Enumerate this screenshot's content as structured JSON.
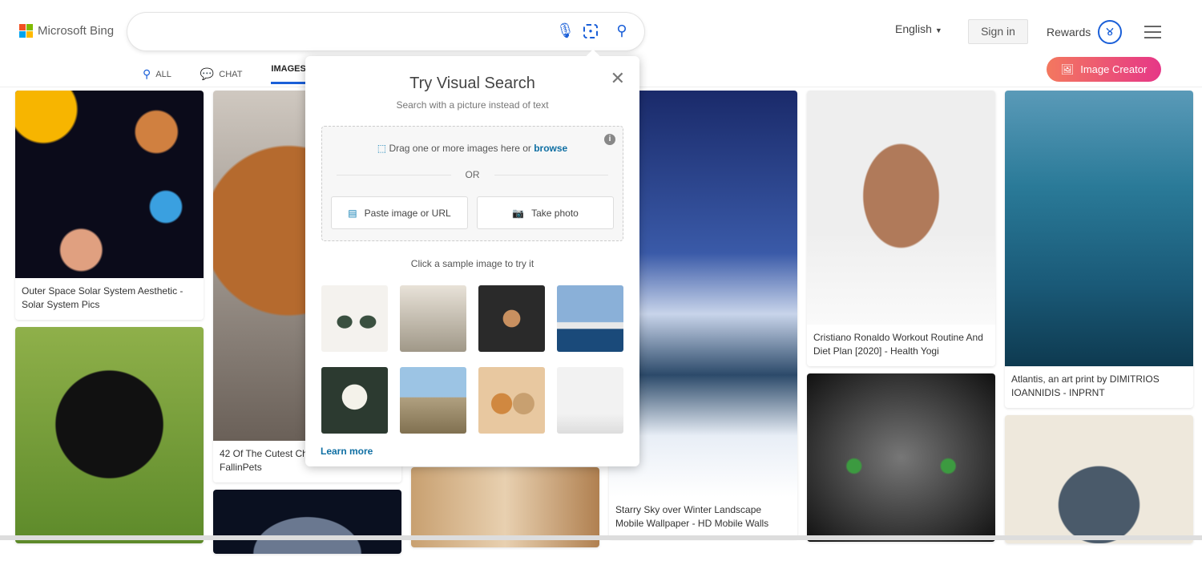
{
  "header": {
    "brand": "Microsoft Bing",
    "search_value": "",
    "language": "English",
    "sign_in": "Sign in",
    "rewards": "Rewards",
    "image_creator": "Image Creator"
  },
  "nav": [
    {
      "label": "ALL",
      "icon": "search-icon"
    },
    {
      "label": "CHAT",
      "icon": "chat-icon"
    },
    {
      "label": "IMAGES"
    }
  ],
  "popup": {
    "title": "Try Visual Search",
    "subtitle": "Search with a picture instead of text",
    "drag_text": "Drag one or more images here or",
    "browse": "browse",
    "or": "OR",
    "paste": "Paste image or URL",
    "take_photo": "Take photo",
    "sample_text": "Click a sample image to try it",
    "learn_more": "Learn more",
    "samples": [
      "sunglasses",
      "dining room",
      "latte art",
      "sydney opera house",
      "white rose",
      "louvre pyramid",
      "dogs",
      "chair"
    ]
  },
  "results": [
    {
      "caption": "Outer Space Solar System Aesthetic - Solar System Pics"
    },
    {
      "caption": "42 Of The Cutest Ch\nFallinPets"
    },
    {
      "caption": "Starry Sky over Winter Landscape Mobile Wallpaper - HD Mobile Walls"
    },
    {
      "caption": "Cristiano Ronaldo Workout Routine And Diet Plan [2020] - Health Yogi"
    },
    {
      "caption": "Atlantis, an art print by DIMITRIOS IOANNIDIS - INPRNT"
    }
  ],
  "colors": {
    "accent": "#1a5fd8",
    "link": "#0f6fa3",
    "creator_start": "#f3785f",
    "creator_end": "#e63787"
  }
}
